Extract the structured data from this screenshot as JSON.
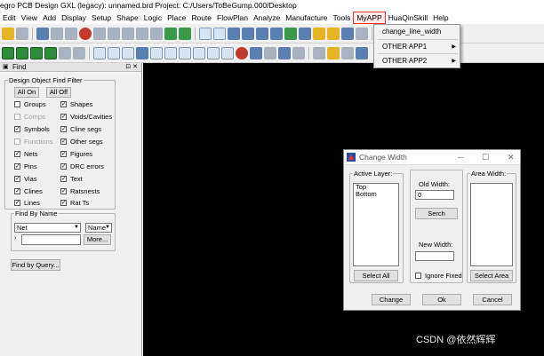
{
  "window": {
    "title": "egro PCB Design GXL (legacy): unnamed.brd  Project: C:/Users/ToBeGump.000/Desktop"
  },
  "menu": [
    {
      "label": "Edit"
    },
    {
      "label": "View"
    },
    {
      "label": "Add"
    },
    {
      "label": "Display"
    },
    {
      "label": "Setup"
    },
    {
      "label": "Shape"
    },
    {
      "label": "Logic"
    },
    {
      "label": "Place"
    },
    {
      "label": "Route"
    },
    {
      "label": "FlowPlan"
    },
    {
      "label": "Analyze"
    },
    {
      "label": "Manufacture"
    },
    {
      "label": "Tools"
    },
    {
      "label": "MyAPP"
    },
    {
      "label": "HuaQinSkill"
    },
    {
      "label": "Help"
    }
  ],
  "myapp_menu": {
    "items": [
      {
        "label": "change_line_width"
      },
      {
        "label": "OTHER APP1"
      },
      {
        "label": "OTHER APP2"
      }
    ]
  },
  "find_panel": {
    "title": "Find",
    "filter_group": "Design Object Find Filter",
    "all_on": "All On",
    "all_off": "All Off",
    "checks": [
      {
        "label": "Groups",
        "checked": false,
        "disabled": false
      },
      {
        "label": "Shapes",
        "checked": true,
        "disabled": false
      },
      {
        "label": "Comps",
        "checked": false,
        "disabled": true
      },
      {
        "label": "Voids/Cavities",
        "checked": true,
        "disabled": false
      },
      {
        "label": "Symbols",
        "checked": true,
        "disabled": false
      },
      {
        "label": "Cline segs",
        "checked": true,
        "disabled": false
      },
      {
        "label": "Functions",
        "checked": false,
        "disabled": true
      },
      {
        "label": "Other segs",
        "checked": true,
        "disabled": false
      },
      {
        "label": "Nets",
        "checked": true,
        "disabled": false
      },
      {
        "label": "Figures",
        "checked": true,
        "disabled": false
      },
      {
        "label": "Pins",
        "checked": true,
        "disabled": false
      },
      {
        "label": "DRC errors",
        "checked": true,
        "disabled": false
      },
      {
        "label": "Vias",
        "checked": true,
        "disabled": false
      },
      {
        "label": "Text",
        "checked": true,
        "disabled": false
      },
      {
        "label": "Clines",
        "checked": true,
        "disabled": false
      },
      {
        "label": "Ratsnests",
        "checked": true,
        "disabled": false
      },
      {
        "label": "Lines",
        "checked": true,
        "disabled": false
      },
      {
        "label": "Rat Ts",
        "checked": true,
        "disabled": false
      }
    ],
    "find_by_name_group": "Find By Name",
    "type_select": "Net",
    "mode_select": "Name",
    "name_input": "",
    "more_button": "More...",
    "find_by_query_button": "Find by Query..."
  },
  "dialog": {
    "title": "Change Width",
    "active_layer_label": "Active Layer:",
    "layers": [
      "Top",
      "Bottom"
    ],
    "select_all": "Select All",
    "old_width_label": "Old Width:",
    "old_width_value": "0",
    "search_button": "Serch",
    "new_width_label": "New Width:",
    "new_width_value": "",
    "ignore_fixed": "Ignore Fixed",
    "area_width_label": "Area Width:",
    "select_area": "Select Area",
    "change_button": "Change",
    "ok_button": "Ok",
    "cancel_button": "Cancel"
  },
  "watermark": "CSDN @依然辉辉",
  "colors": {
    "canvas": "#000000",
    "menu_highlight": "#ee3333"
  }
}
